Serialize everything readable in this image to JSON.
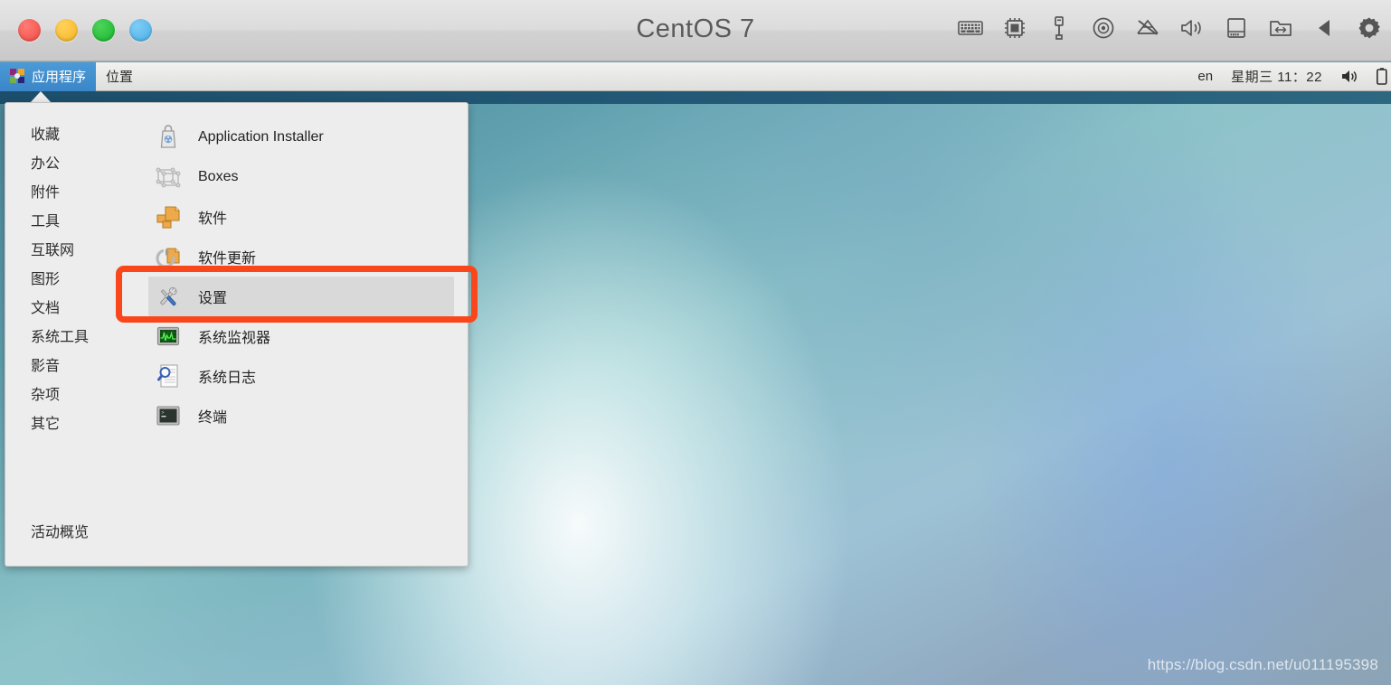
{
  "window": {
    "title": "CentOS 7",
    "controls": [
      {
        "name": "close",
        "color": "#f04b45"
      },
      {
        "name": "minimize",
        "color": "#f5b423"
      },
      {
        "name": "maximize",
        "color": "#16b52c"
      },
      {
        "name": "unity",
        "color": "#4aaee8"
      }
    ],
    "toolbar_icons": [
      "keyboard-icon",
      "processor-icon",
      "usb-icon",
      "optical-disc-icon",
      "network-disconnected-icon",
      "sound-icon",
      "hard-drive-icon",
      "shared-folder-icon",
      "back-arrow-icon",
      "settings-gear-icon"
    ]
  },
  "panel": {
    "applications_label": "应用程序",
    "places_label": "位置",
    "keyboard_layout": "en",
    "clock": "星期三 11：22",
    "volume_icon": "volume-icon",
    "battery_icon": "battery-icon"
  },
  "menu": {
    "categories": [
      "收藏",
      "办公",
      "附件",
      "工具",
      "互联网",
      "图形",
      "文档",
      "系统工具",
      "影音",
      "杂项",
      "其它"
    ],
    "overview_label": "活动概览",
    "applications": [
      {
        "label": "Application Installer",
        "icon": "application-installer-icon",
        "selected": false
      },
      {
        "label": "Boxes",
        "icon": "boxes-icon",
        "selected": false
      },
      {
        "label": "软件",
        "icon": "software-icon",
        "selected": false
      },
      {
        "label": "软件更新",
        "icon": "software-update-icon",
        "selected": false
      },
      {
        "label": "设置",
        "icon": "settings-tools-icon",
        "selected": true
      },
      {
        "label": "系统监视器",
        "icon": "system-monitor-icon",
        "selected": false
      },
      {
        "label": "系统日志",
        "icon": "system-log-icon",
        "selected": false
      },
      {
        "label": "终端",
        "icon": "terminal-icon",
        "selected": false
      }
    ]
  },
  "annotation": {
    "target_label": "设置",
    "color": "#f9471b"
  },
  "desktop": {
    "watermark": "https://blog.csdn.net/u011195398"
  }
}
